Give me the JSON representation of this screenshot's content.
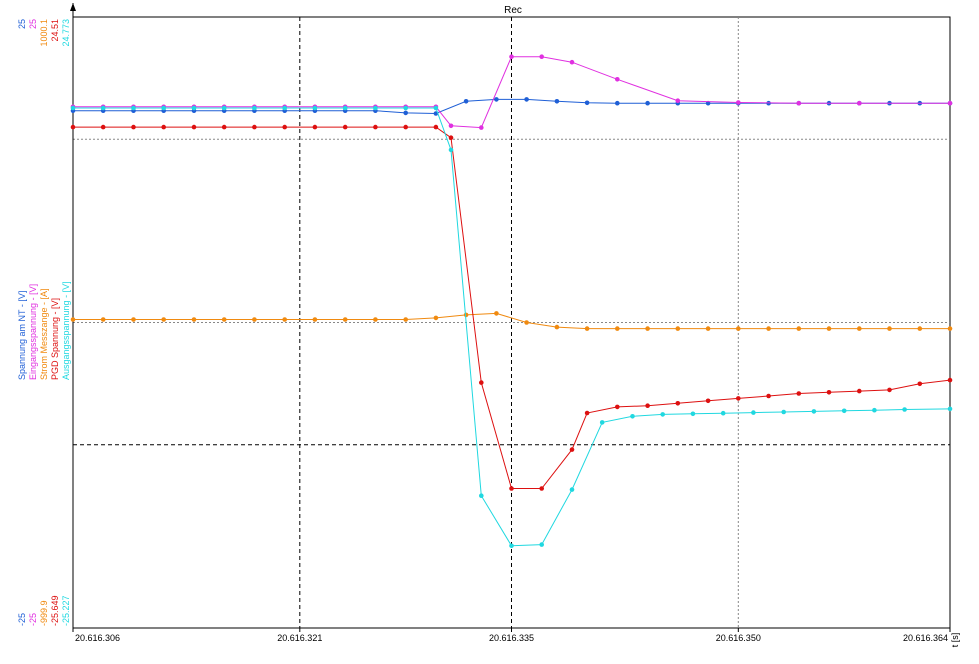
{
  "chart_data": {
    "type": "line",
    "title": "Rec",
    "xlabel": "t [s]",
    "x_tick_labels": [
      "20.616.306",
      "20.616.321",
      "20.616.335",
      "20.616.350",
      "20.616.364"
    ],
    "xlim": [
      20616.306,
      20616.364
    ],
    "grid": true,
    "series": [
      {
        "name": "Spannung am NT - [V]",
        "color": "#1f5fd6",
        "axis_max": "25",
        "axis_min": "-25",
        "ylim": [
          -25,
          25
        ],
        "x": [
          20616.306,
          20616.308,
          20616.31,
          20616.312,
          20616.314,
          20616.316,
          20616.318,
          20616.32,
          20616.322,
          20616.324,
          20616.326,
          20616.328,
          20616.33,
          20616.332,
          20616.334,
          20616.336,
          20616.338,
          20616.34,
          20616.342,
          20616.344,
          20616.346,
          20616.348,
          20616.35,
          20616.352,
          20616.354,
          20616.356,
          20616.358,
          20616.36,
          20616.362,
          20616.364
        ],
        "values": [
          17.33,
          17.33,
          17.33,
          17.33,
          17.33,
          17.33,
          17.33,
          17.33,
          17.33,
          17.33,
          17.33,
          17.15,
          17.1,
          18.1,
          18.26,
          18.26,
          18.1,
          17.98,
          17.95,
          17.95,
          17.95,
          17.95,
          17.95,
          17.95,
          17.95,
          17.95,
          17.95,
          17.95,
          17.95,
          17.95
        ]
      },
      {
        "name": "Eingangsspannung - [V]",
        "color": "#e030e0",
        "axis_max": "25",
        "axis_min": "-25",
        "ylim": [
          -25,
          25
        ],
        "x": [
          20616.306,
          20616.308,
          20616.31,
          20616.312,
          20616.314,
          20616.316,
          20616.318,
          20616.32,
          20616.322,
          20616.324,
          20616.326,
          20616.328,
          20616.33,
          20616.331,
          20616.333,
          20616.335,
          20616.337,
          20616.339,
          20616.342,
          20616.346,
          20616.35,
          20616.354,
          20616.358,
          20616.364
        ],
        "values": [
          17.65,
          17.65,
          17.65,
          17.65,
          17.65,
          17.65,
          17.65,
          17.65,
          17.65,
          17.65,
          17.65,
          17.65,
          17.65,
          16.1,
          15.95,
          21.75,
          21.75,
          21.3,
          19.9,
          18.15,
          18.0,
          17.95,
          17.95,
          17.95
        ]
      },
      {
        "name": "Strom Messzange - [A]",
        "color": "#f08a10",
        "axis_max": "1000.1",
        "axis_min": "-999.9",
        "ylim": [
          -999.9,
          1000.1
        ],
        "x": [
          20616.306,
          20616.308,
          20616.31,
          20616.312,
          20616.314,
          20616.316,
          20616.318,
          20616.32,
          20616.322,
          20616.324,
          20616.326,
          20616.328,
          20616.33,
          20616.332,
          20616.334,
          20616.336,
          20616.338,
          20616.34,
          20616.342,
          20616.344,
          20616.346,
          20616.348,
          20616.35,
          20616.352,
          20616.354,
          20616.356,
          20616.358,
          20616.36,
          20616.362,
          20616.364
        ],
        "values": [
          10,
          10,
          10,
          10,
          10,
          10,
          10,
          10,
          10,
          10,
          10,
          10,
          15,
          25,
          30,
          0,
          -15,
          -20,
          -20,
          -20,
          -20,
          -20,
          -20,
          -20,
          -20,
          -20,
          -20,
          -20,
          -20,
          -20
        ]
      },
      {
        "name": "PGD Spannung - [V]",
        "color": "#dd1010",
        "axis_max": "24.51",
        "axis_min": "-25.649",
        "ylim": [
          -25.649,
          24.51
        ],
        "x": [
          20616.306,
          20616.308,
          20616.31,
          20616.312,
          20616.314,
          20616.316,
          20616.318,
          20616.32,
          20616.322,
          20616.324,
          20616.326,
          20616.328,
          20616.33,
          20616.331,
          20616.333,
          20616.335,
          20616.337,
          20616.339,
          20616.34,
          20616.342,
          20616.344,
          20616.346,
          20616.348,
          20616.35,
          20616.352,
          20616.354,
          20616.356,
          20616.358,
          20616.36,
          20616.362,
          20616.364
        ],
        "values": [
          15.47,
          15.47,
          15.47,
          15.47,
          15.47,
          15.47,
          15.47,
          15.47,
          15.47,
          15.47,
          15.47,
          15.47,
          15.47,
          14.6,
          -5.5,
          -14.2,
          -14.2,
          -11.0,
          -8.0,
          -7.5,
          -7.4,
          -7.2,
          -7.0,
          -6.8,
          -6.6,
          -6.4,
          -6.3,
          -6.2,
          -6.1,
          -5.6,
          -5.3
        ]
      },
      {
        "name": "Ausgangsspannung - [V]",
        "color": "#20d8e0",
        "axis_max": "24.773",
        "axis_min": "-25.227",
        "ylim": [
          -25.227,
          24.773
        ],
        "x": [
          20616.306,
          20616.308,
          20616.31,
          20616.312,
          20616.314,
          20616.316,
          20616.318,
          20616.32,
          20616.322,
          20616.324,
          20616.326,
          20616.328,
          20616.33,
          20616.331,
          20616.333,
          20616.335,
          20616.337,
          20616.339,
          20616.341,
          20616.343,
          20616.345,
          20616.347,
          20616.349,
          20616.351,
          20616.353,
          20616.355,
          20616.357,
          20616.359,
          20616.361,
          20616.364
        ],
        "values": [
          17.33,
          17.33,
          17.33,
          17.33,
          17.33,
          17.33,
          17.33,
          17.33,
          17.33,
          17.33,
          17.33,
          17.33,
          17.33,
          13.9,
          -14.4,
          -18.5,
          -18.4,
          -13.9,
          -8.4,
          -7.9,
          -7.75,
          -7.7,
          -7.65,
          -7.6,
          -7.55,
          -7.5,
          -7.45,
          -7.4,
          -7.35,
          -7.3
        ]
      }
    ]
  }
}
